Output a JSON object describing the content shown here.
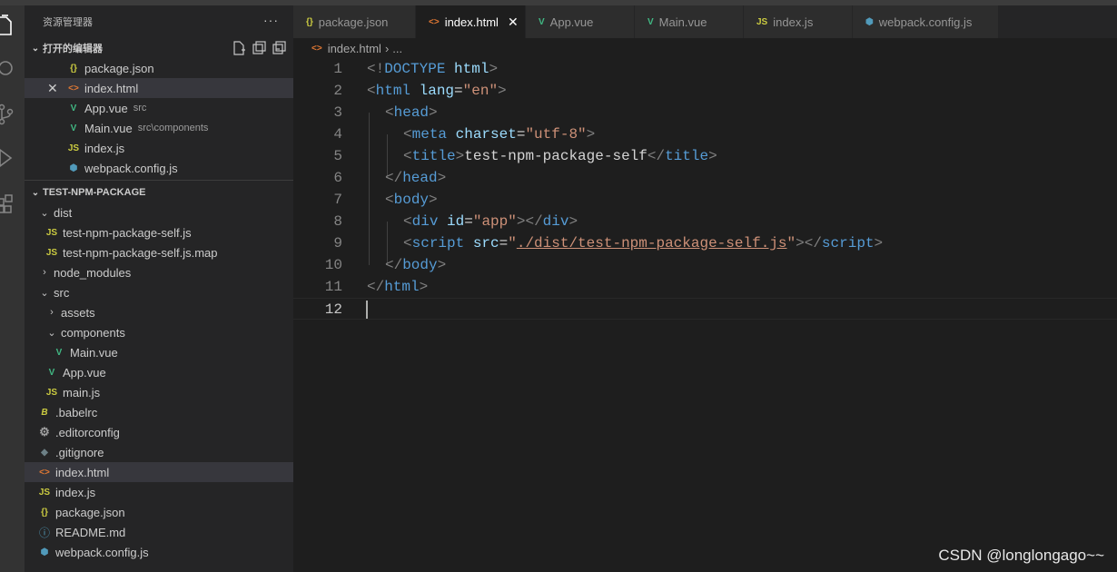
{
  "sidebar": {
    "title": "资源管理器",
    "more": "···",
    "open_editors": {
      "header": "打开的编辑器",
      "items": [
        {
          "icon": "{}",
          "label": "package.json",
          "desc": ""
        },
        {
          "icon": "<>",
          "label": "index.html",
          "desc": ""
        },
        {
          "icon": "V",
          "label": "App.vue",
          "desc": "src"
        },
        {
          "icon": "V",
          "label": "Main.vue",
          "desc": "src\\components"
        },
        {
          "icon": "JS",
          "label": "index.js",
          "desc": ""
        },
        {
          "icon": "⬢",
          "label": "webpack.config.js",
          "desc": ""
        }
      ]
    },
    "project": {
      "header": "TEST-NPM-PACKAGE",
      "tree": [
        {
          "twisty": "⌄",
          "icon": "",
          "label": "dist"
        },
        {
          "twisty": "",
          "icon": "JS",
          "label": "test-npm-package-self.js"
        },
        {
          "twisty": "",
          "icon": "JS",
          "label": "test-npm-package-self.js.map"
        },
        {
          "twisty": "›",
          "icon": "",
          "label": "node_modules"
        },
        {
          "twisty": "⌄",
          "icon": "",
          "label": "src"
        },
        {
          "twisty": "›",
          "icon": "",
          "label": "assets"
        },
        {
          "twisty": "⌄",
          "icon": "",
          "label": "components"
        },
        {
          "twisty": "",
          "icon": "V",
          "label": "Main.vue"
        },
        {
          "twisty": "",
          "icon": "V",
          "label": "App.vue"
        },
        {
          "twisty": "",
          "icon": "JS",
          "label": "main.js"
        },
        {
          "twisty": "",
          "icon": "B",
          "label": ".babelrc"
        },
        {
          "twisty": "",
          "icon": "⚙",
          "label": ".editorconfig"
        },
        {
          "twisty": "",
          "icon": "◆",
          "label": ".gitignore"
        },
        {
          "twisty": "",
          "icon": "<>",
          "label": "index.html"
        },
        {
          "twisty": "",
          "icon": "JS",
          "label": "index.js"
        },
        {
          "twisty": "",
          "icon": "{}",
          "label": "package.json"
        },
        {
          "twisty": "",
          "icon": "ⓘ",
          "label": "README.md"
        },
        {
          "twisty": "",
          "icon": "⬢",
          "label": "webpack.config.js"
        }
      ]
    }
  },
  "tabs": [
    {
      "icon": "{}",
      "label": "package.json"
    },
    {
      "icon": "<>",
      "label": "index.html",
      "close": "✕"
    },
    {
      "icon": "V",
      "label": "App.vue"
    },
    {
      "icon": "V",
      "label": "Main.vue"
    },
    {
      "icon": "JS",
      "label": "index.js"
    },
    {
      "icon": "⬢",
      "label": "webpack.config.js"
    }
  ],
  "breadcrumb": {
    "icon": "<>",
    "file": "index.html",
    "sep": "›",
    "rest": "..."
  },
  "editor": {
    "lines": [
      {
        "n": "1"
      },
      {
        "n": "2"
      },
      {
        "n": "3"
      },
      {
        "n": "4"
      },
      {
        "n": "5"
      },
      {
        "n": "6"
      },
      {
        "n": "7"
      },
      {
        "n": "8"
      },
      {
        "n": "9"
      },
      {
        "n": "10"
      },
      {
        "n": "11"
      },
      {
        "n": "12"
      }
    ],
    "tokens": {
      "l1": [
        "<!",
        "DOCTYPE",
        " html",
        ">"
      ],
      "l2": [
        "<",
        "html",
        " lang",
        "=",
        "\"en\"",
        ">"
      ],
      "l3": [
        "<",
        "head",
        ">"
      ],
      "l4": [
        "<",
        "meta",
        " charset",
        "=",
        "\"utf-8\"",
        ">"
      ],
      "l5": [
        "<",
        "title",
        ">",
        "test-npm-package-self",
        "</",
        "title",
        ">"
      ],
      "l6": [
        "</",
        "head",
        ">"
      ],
      "l7": [
        "<",
        "body",
        ">"
      ],
      "l8": [
        "<",
        "div",
        " id",
        "=",
        "\"app\"",
        "></",
        "div",
        ">"
      ],
      "l9": [
        "<",
        "script",
        " src",
        "=",
        "\"",
        "./dist/test-npm-package-self.js",
        "\"",
        "></",
        "script",
        ">"
      ],
      "l10": [
        "</",
        "body",
        ">"
      ],
      "l11": [
        "</",
        "html",
        ">"
      ]
    }
  },
  "watermark": "CSDN @longlongago~~"
}
